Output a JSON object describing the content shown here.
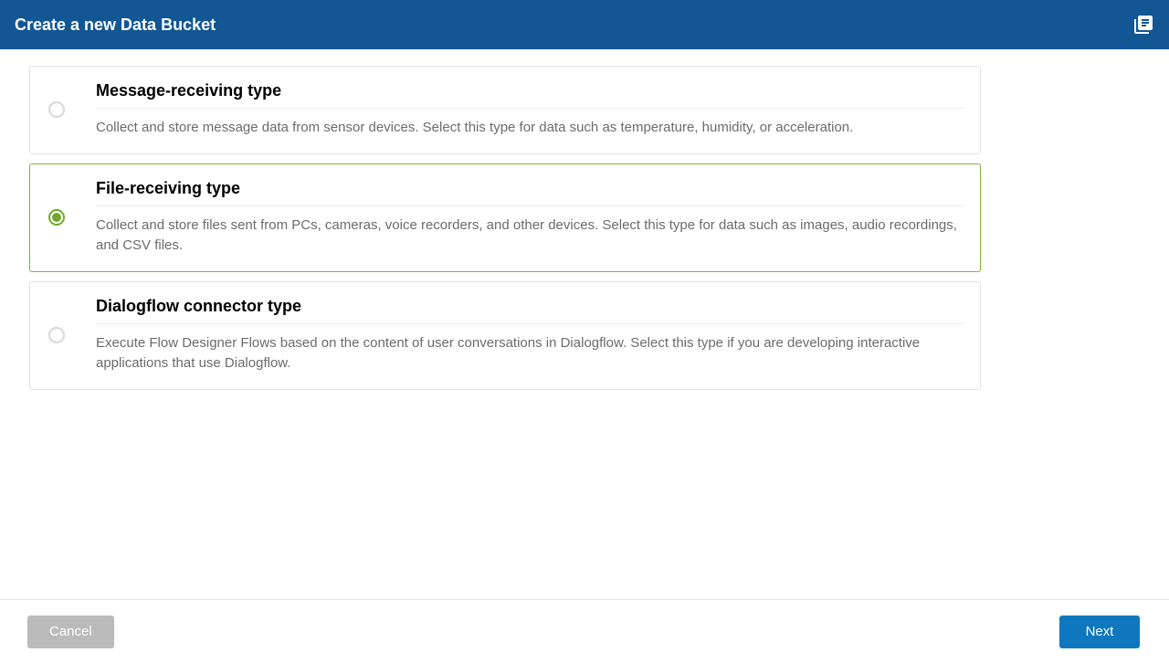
{
  "header": {
    "title": "Create a new Data Bucket"
  },
  "options": [
    {
      "id": "message",
      "title": "Message-receiving type",
      "description": "Collect and store message data from sensor devices. Select this type for data such as temperature, humidity, or acceleration.",
      "selected": false
    },
    {
      "id": "file",
      "title": "File-receiving type",
      "description": "Collect and store files sent from PCs, cameras, voice recorders, and other devices. Select this type for data such as images, audio recordings, and CSV files.",
      "selected": true
    },
    {
      "id": "dialogflow",
      "title": "Dialogflow connector type",
      "description": "Execute Flow Designer Flows based on the content of user conversations in Dialogflow. Select this type if you are developing interactive applications that use Dialogflow.",
      "selected": false
    }
  ],
  "footer": {
    "cancel_label": "Cancel",
    "next_label": "Next"
  }
}
